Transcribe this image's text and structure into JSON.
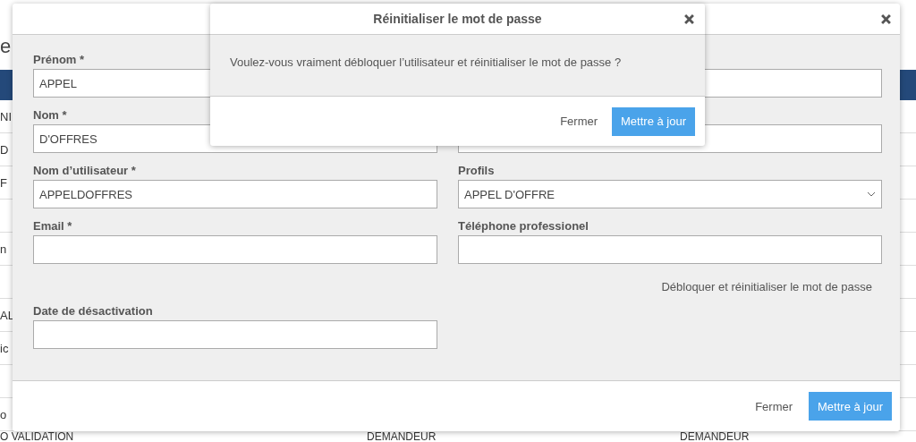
{
  "background_page": {
    "heading": "e",
    "rows": [
      {
        "column_1": "NI"
      },
      {
        "column_1": "D"
      },
      {
        "column_1": "F"
      },
      {
        "column_1": ""
      },
      {
        "column_1": "n"
      },
      {
        "column_1": ""
      },
      {
        "column_1": "AL"
      },
      {
        "column_1": "ic"
      },
      {
        "column_1": ""
      },
      {
        "column_1": "o"
      }
    ],
    "last_row": [
      "O VALIDATION",
      "DEMANDEUR",
      "DEMANDEUR"
    ]
  },
  "user_modal": {
    "rows": [
      {
        "left": {
          "kind": "text",
          "label": "Prénom *",
          "value": "APPEL"
        },
        "right": {
          "kind": "text"
        }
      },
      {
        "left": {
          "kind": "text",
          "label": "Nom *",
          "value": "D'OFFRES"
        },
        "right": {
          "kind": "text"
        }
      },
      {
        "left": {
          "kind": "text",
          "label": "Nom d’utilisateur *",
          "value": "APPELDOFFRES"
        },
        "right": {
          "kind": "select",
          "label": "Profils",
          "value": "APPEL D'OFFRE"
        }
      },
      {
        "left": {
          "kind": "text",
          "label": "Email *"
        },
        "right": {
          "kind": "text",
          "label": "Téléphone professionel"
        }
      },
      {
        "right": {
          "kind": "link",
          "label": "Débloquer et réinitialiser le mot de passe"
        }
      },
      {
        "left": {
          "kind": "text",
          "label": "Date de désactivation"
        }
      }
    ],
    "buttons": {
      "close": "Fermer",
      "submit": "Mettre à jour"
    }
  },
  "confirm_dialog": {
    "title": "Réinitialiser le mot de passe",
    "message": "Voulez-vous vraiment débloquer l’utilisateur et réinitialiser le mot de passe ?",
    "buttons": {
      "close": "Fermer",
      "submit": "Mettre à jour"
    }
  }
}
